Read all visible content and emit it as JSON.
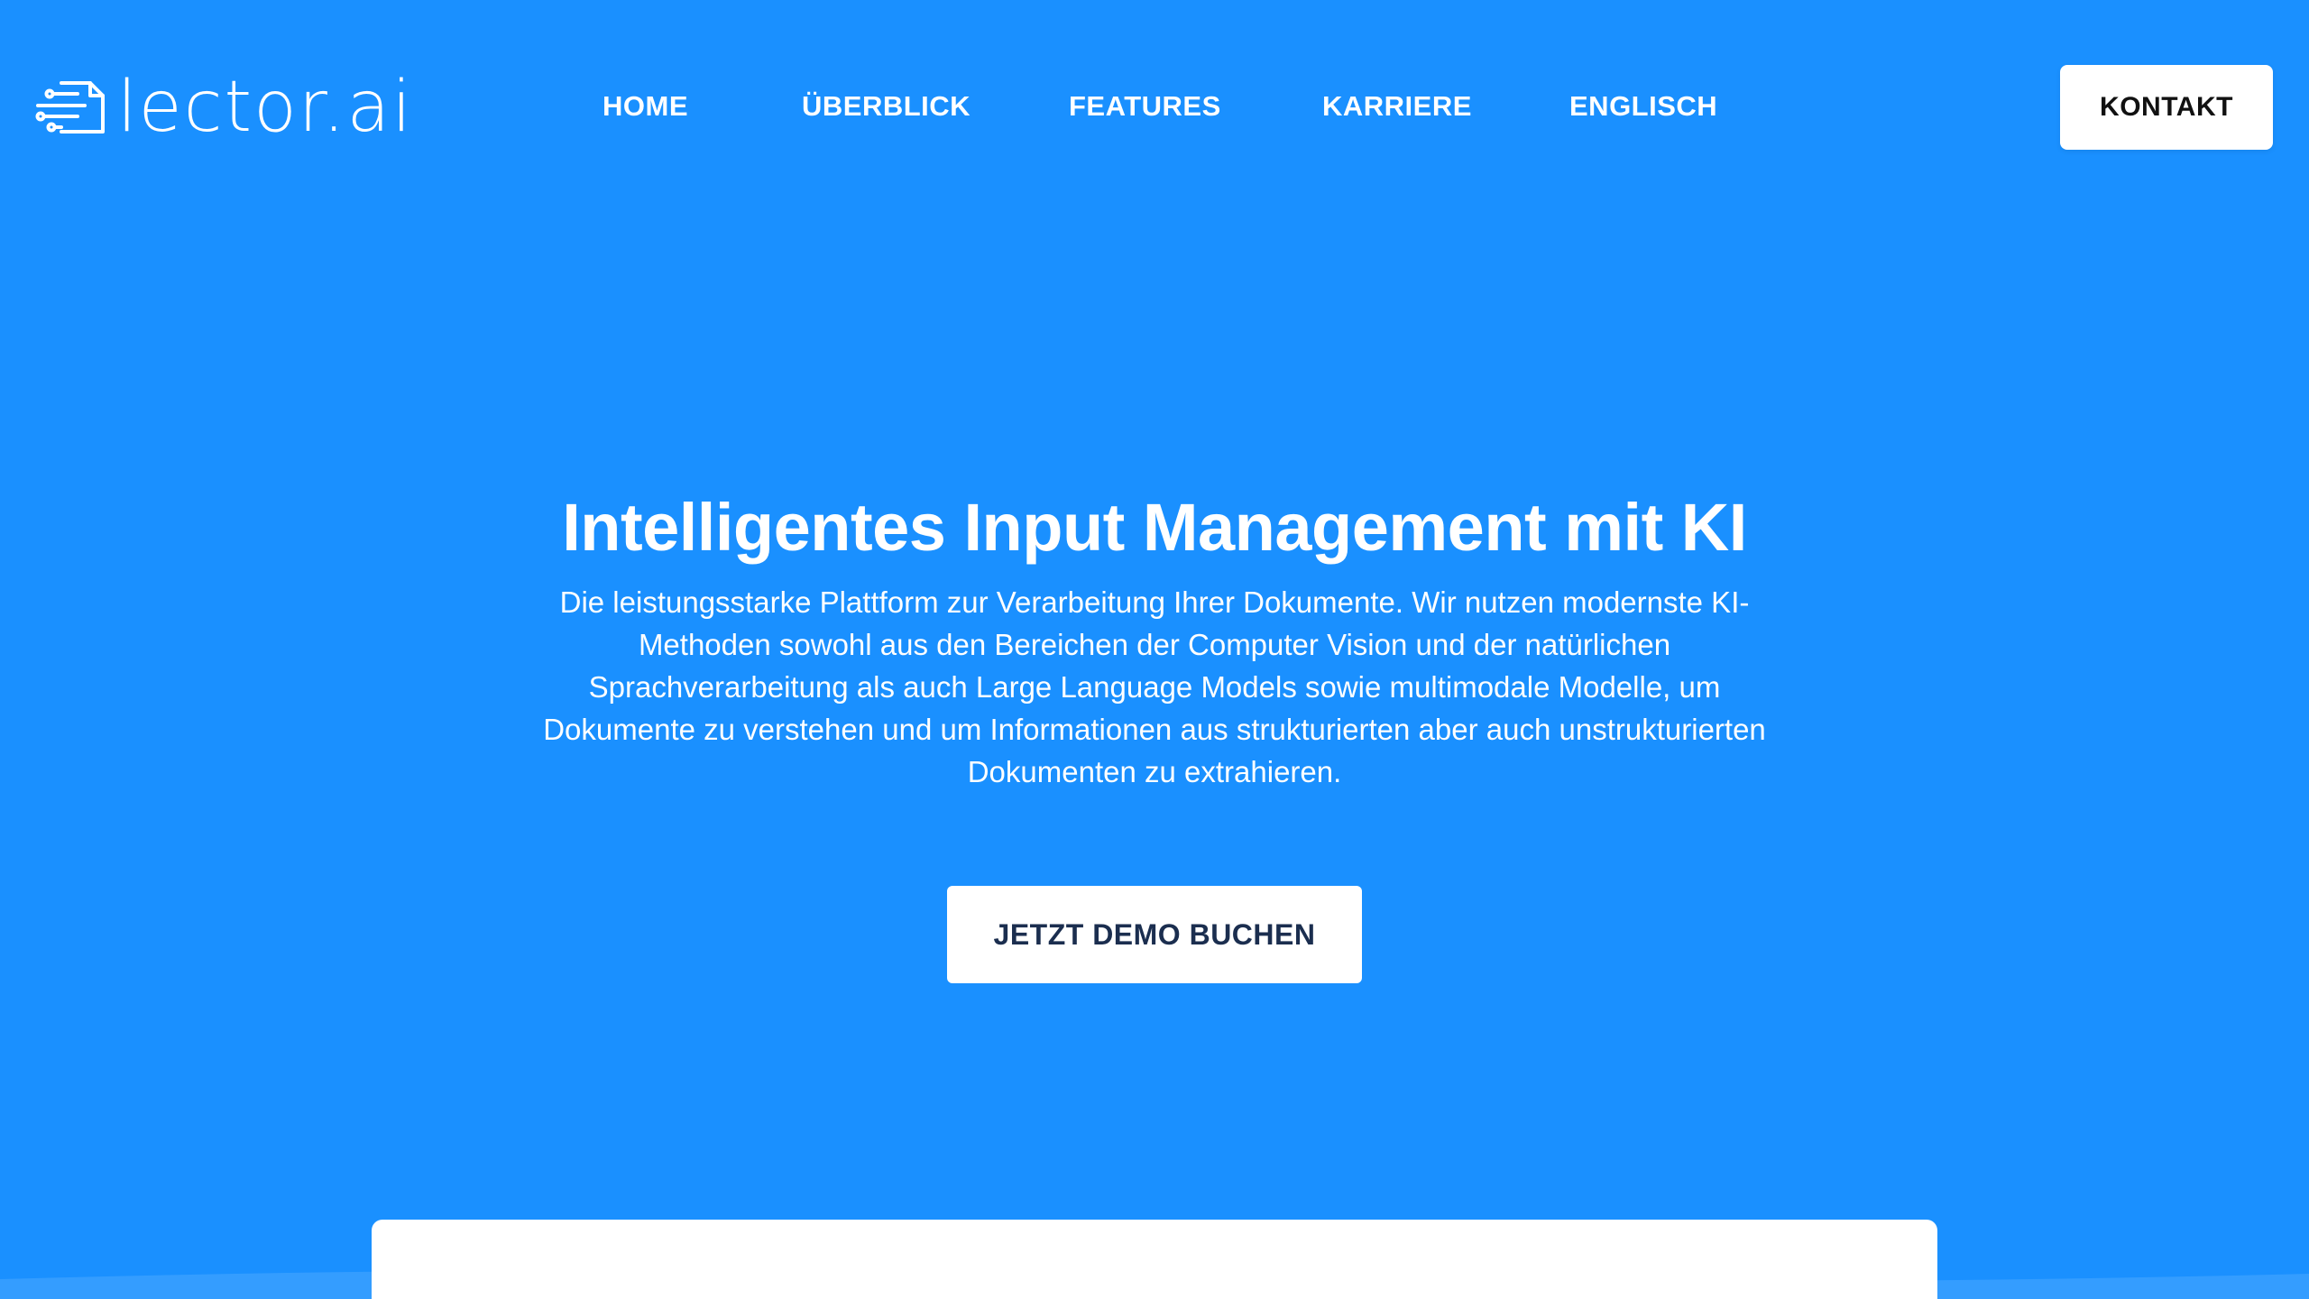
{
  "brand": {
    "name": "lector.ai",
    "logo_icon": "document-circuit-icon"
  },
  "nav": {
    "items": [
      {
        "label": "HOME"
      },
      {
        "label": "ÜBERBLICK"
      },
      {
        "label": "FEATURES"
      },
      {
        "label": "KARRIERE"
      },
      {
        "label": "ENGLISCH"
      }
    ],
    "contact_label": "KONTAKT"
  },
  "hero": {
    "title": "Intelligentes Input Management mit KI",
    "description": "Die leistungsstarke Plattform zur Verarbeitung Ihrer Dokumente. Wir nutzen modernste KI-Methoden sowohl aus den Bereichen der Computer Vision und der natürlichen Sprachverarbeitung als auch Large Language Models sowie multimodale Modelle, um Dokumente zu verstehen und um Informationen aus strukturierten aber auch unstrukturierten Dokumenten zu extrahieren.",
    "cta_label": "JETZT DEMO BUCHEN"
  },
  "colors": {
    "background": "#1a90ff",
    "button_bg": "#ffffff",
    "cta_text": "#1b2e4f",
    "contact_text": "#111111"
  }
}
